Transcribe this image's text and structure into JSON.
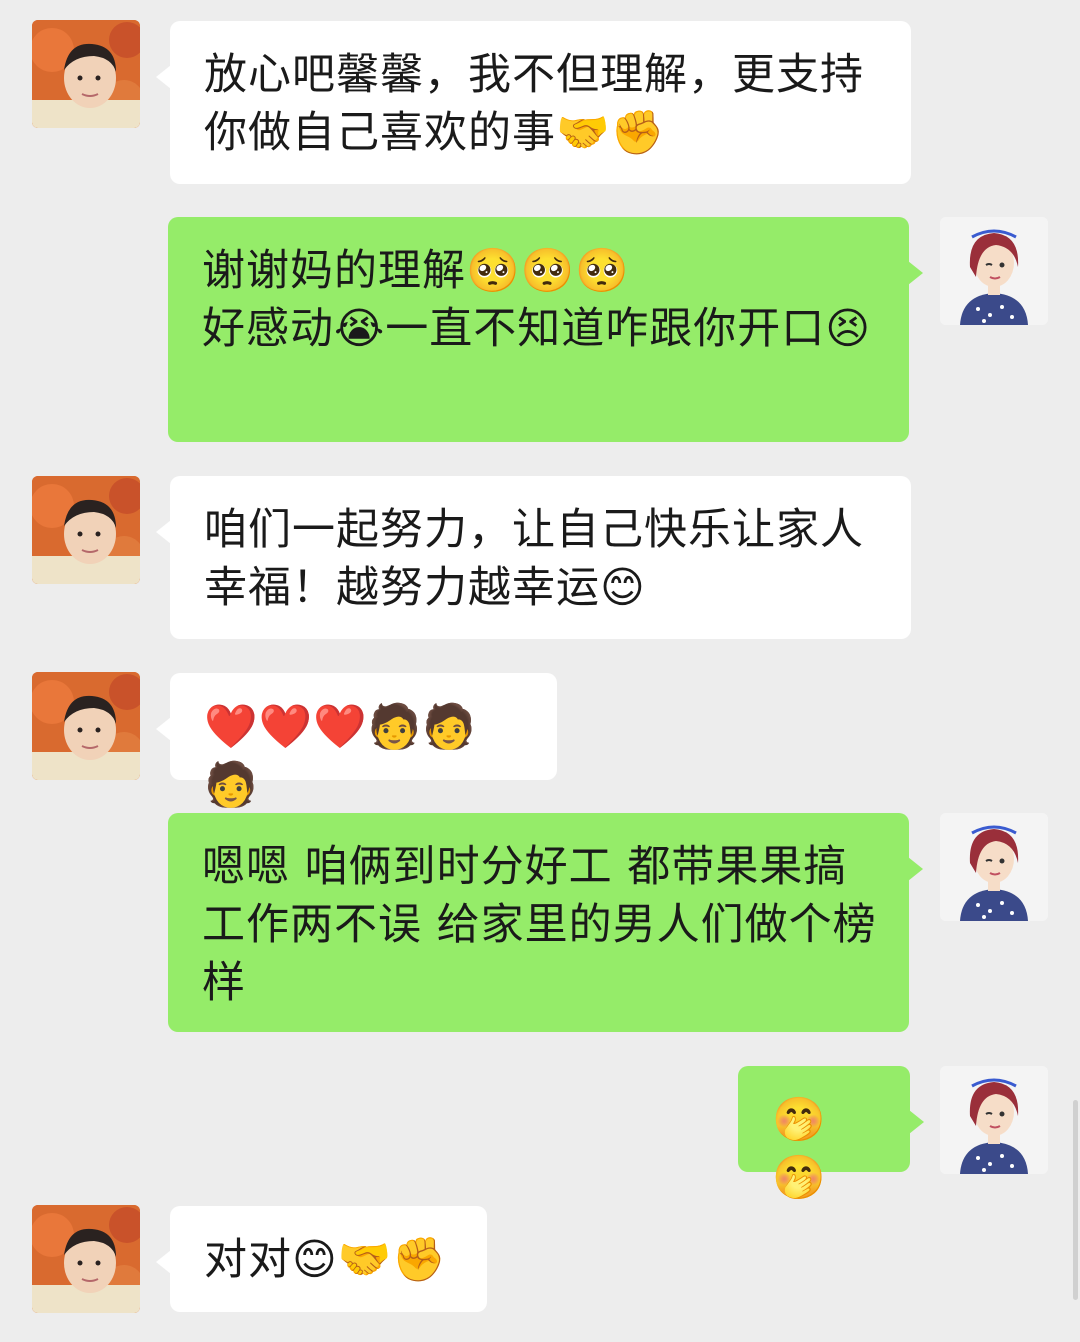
{
  "colors": {
    "background": "#ededed",
    "incoming_bubble": "#ffffff",
    "outgoing_bubble": "#95ec69"
  },
  "messages": [
    {
      "sender": "mom",
      "avatar": "mom-avatar",
      "text": "放心吧馨馨，我不但理解，更支持你做自己喜欢的事🤝✊"
    },
    {
      "sender": "me",
      "avatar": "user-avatar",
      "text": "谢谢妈的理解🥺🥺🥺\n好感动😭一直不知道咋跟你开口😣"
    },
    {
      "sender": "mom",
      "avatar": "mom-avatar",
      "text": "咱们一起努力，让自己快乐让家人幸福！越努力越幸运😊"
    },
    {
      "sender": "mom",
      "avatar": "mom-avatar",
      "text": "❤️❤️❤️🧑🧑🧑"
    },
    {
      "sender": "me",
      "avatar": "user-avatar",
      "text": "嗯嗯 咱俩到时分好工 都带果果搞工作两不误 给家里的男人们做个榜样"
    },
    {
      "sender": "me",
      "avatar": "user-avatar",
      "text": "🤭🤭"
    },
    {
      "sender": "mom",
      "avatar": "mom-avatar",
      "text": "对对😊🤝✊"
    }
  ]
}
